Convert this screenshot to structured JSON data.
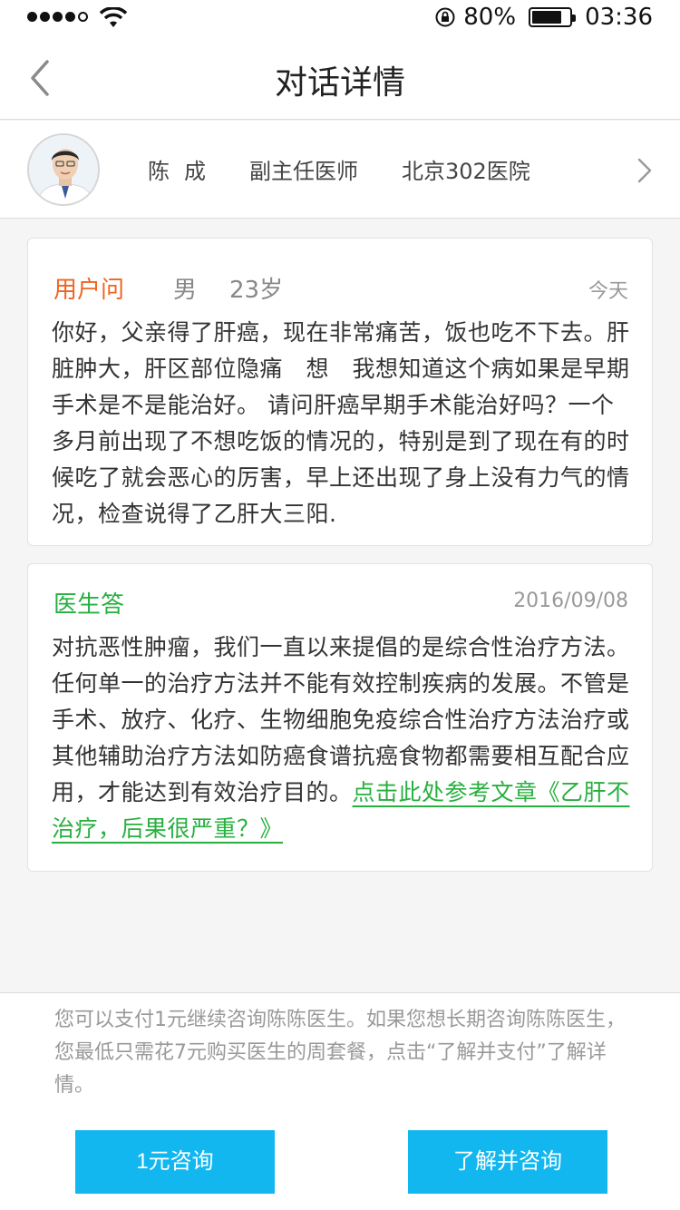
{
  "status_bar": {
    "battery_percent": "80%",
    "battery_level": 0.8,
    "time": "03:36",
    "signal_bars_filled": 4,
    "signal_bars_total": 5
  },
  "nav": {
    "title": "对话详情"
  },
  "doctor": {
    "name": "陈成",
    "title": "副主任医师",
    "hospital": "北京302医院"
  },
  "question": {
    "role": "用户问",
    "gender": "男",
    "age": "23岁",
    "time": "今天",
    "text": "你好，父亲得了肝癌，现在非常痛苦，饭也吃不下去。肝脏肿大，肝区部位隐痛　想　我想知道这个病如果是早期手术是不是能治好。 请问肝癌早期手术能治好吗？一个多月前出现了不想吃饭的情况的，特别是到了现在有的时候吃了就会恶心的厉害，早上还出现了身上没有力气的情况，检查说得了乙肝大三阳."
  },
  "answer": {
    "role": "医生答",
    "time": "2016/09/08",
    "text": "对抗恶性肿瘤，我们一直以来提倡的是综合性治疗方法。任何单一的治疗方法并不能有效控制疾病的发展。不管是手术、放疗、化疗、生物细胞免疫综合性治疗方法治疗或其他辅助治疗方法如防癌食谱抗癌食物都需要相互配合应用，才能达到有效治疗目的。",
    "link_text": "点击此处参考文章《乙肝不治疗，后果很严重？》"
  },
  "footer": {
    "notice": "您可以支付1元继续咨询陈陈医生。如果您想长期咨询陈陈医生，您最低只需花7元购买医生的周套餐，点击“了解并支付”了解详情。",
    "btn_left": "1元咨询",
    "btn_right": "了解并咨询"
  },
  "colors": {
    "question_role": "#f06420",
    "answer_role": "#27b03f",
    "button": "#12b7f0"
  }
}
